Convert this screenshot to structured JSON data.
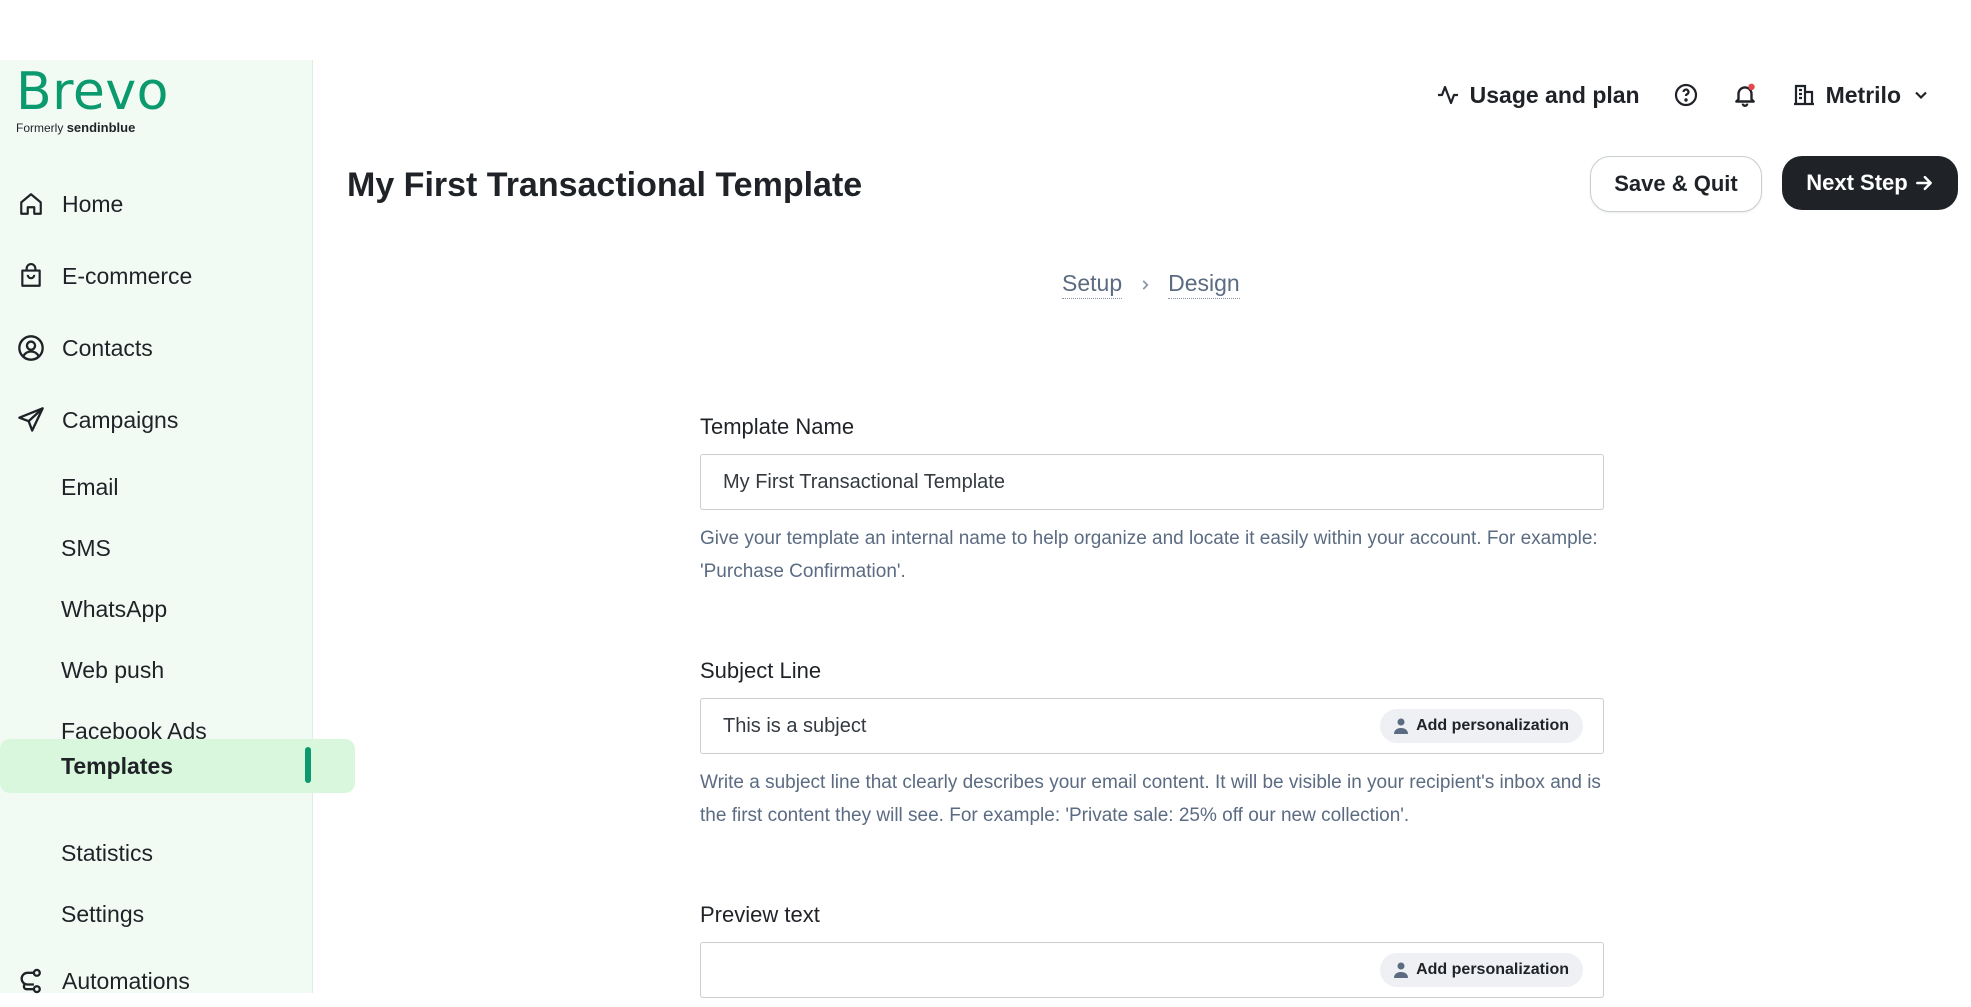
{
  "logo": {
    "word": "Brevo",
    "formerly": "Formerly",
    "brand": "sendinblue"
  },
  "sidebar": {
    "items": [
      {
        "label": "Home",
        "icon": "home-icon"
      },
      {
        "label": "E-commerce",
        "icon": "shopping-bag-icon"
      },
      {
        "label": "Contacts",
        "icon": "user-circle-icon"
      },
      {
        "label": "Campaigns",
        "icon": "paper-plane-icon"
      },
      {
        "label": "Email"
      },
      {
        "label": "SMS"
      },
      {
        "label": "WhatsApp"
      },
      {
        "label": "Web push"
      },
      {
        "label": "Facebook Ads"
      },
      {
        "label": "Templates",
        "active": true
      },
      {
        "label": "Statistics"
      },
      {
        "label": "Settings"
      },
      {
        "label": "Automations",
        "icon": "automation-icon"
      }
    ]
  },
  "topbar": {
    "usage_label": "Usage and plan",
    "account_label": "Metrilo",
    "notification_dot_color": "#e5484d"
  },
  "page": {
    "title": "My First Transactional Template",
    "save_quit_label": "Save & Quit",
    "next_step_label": "Next Step"
  },
  "breadcrumb": {
    "step1": "Setup",
    "step2": "Design"
  },
  "form": {
    "template_name": {
      "label": "Template Name",
      "value": "My First Transactional Template",
      "help": "Give your template an internal name to help organize and locate it easily within your account. For example: 'Purchase Confirmation'."
    },
    "subject_line": {
      "label": "Subject Line",
      "value": "This is a subject",
      "personalization_label": "Add personalization",
      "help": "Write a subject line that clearly describes your email content. It will be visible in your recipient's inbox and is the first content they will see. For example: 'Private sale: 25% off our new collection'."
    },
    "preview_text": {
      "label": "Preview text",
      "value": "",
      "personalization_label": "Add personalization"
    }
  },
  "colors": {
    "brand_green": "#0b996e",
    "sidebar_bg": "#f1fbf3",
    "active_bg": "#d8f7dc",
    "dark": "#1f2328"
  }
}
